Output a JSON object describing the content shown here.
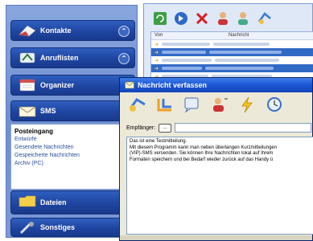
{
  "sidebar": {
    "kontakte": "Kontakte",
    "anruflisten": "Anruflisten",
    "organizer": "Organizer",
    "sms": "SMS",
    "sms_items": {
      "posteingang": "Posteingang",
      "entwuerfe": "Entwürfe",
      "gesendet": "Gesendete Nachrichten",
      "gespeichert": "Gespeicherte Nachrichten",
      "archiv": "Archiv (PC)"
    },
    "dateien": "Dateien",
    "sonstiges": "Sonstiges"
  },
  "message_list": {
    "columns": {
      "von": "Von",
      "nachricht": "Nachricht"
    }
  },
  "compose": {
    "title": "Nachricht verfassen",
    "recipient_label": "Empfänger:",
    "recipient_button": "...",
    "body_line1": "Das ist eine Testmitteilung.",
    "body_line2": "Mit diesem Programm kann man neben überlangen Kurzmitteilungen",
    "body_line3": "(VIP)-SMS versenden. Sie können Ihre Nachrichten lokal auf Ihrem",
    "body_line4": "Formaten speichern und bei Bedarf wieder zurück auf das Handy ü"
  },
  "colors": {
    "sidebar_blue": "#1f45a1",
    "titlebar_blue": "#1b55d6",
    "selection_blue": "#316ac5"
  }
}
